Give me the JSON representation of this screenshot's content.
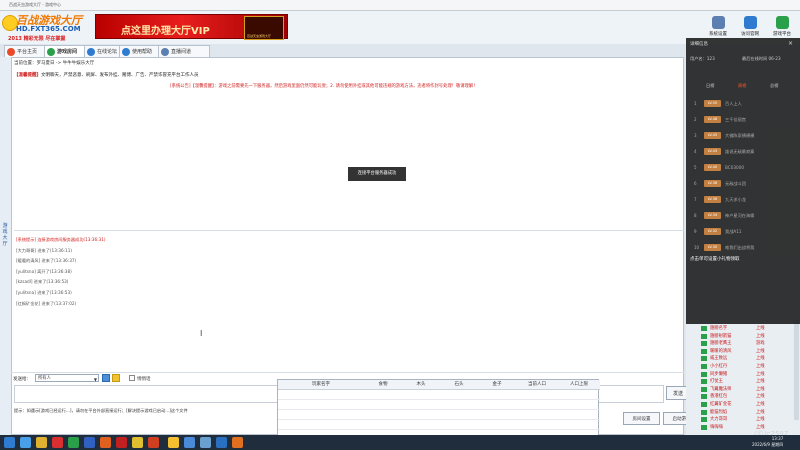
{
  "window": {
    "title": "百战天虫游戏大厅 - 游戏中心"
  },
  "logo": {
    "line1": "百战游戏大厅",
    "line2": "HD.FXT365.COM",
    "line3": "2013 精彩无限 尽在掌握"
  },
  "banner": {
    "text": "点这里办理大厅VIP",
    "emblem": "百战天虫游戏大厅"
  },
  "header_buttons": [
    {
      "label": "系统设置",
      "color": "#5a7fb0"
    },
    {
      "label": "访问官网",
      "color": "#2f7bd0"
    },
    {
      "label": "游戏平台",
      "color": "#2aa04a"
    }
  ],
  "tabs": [
    {
      "label": "平台主页",
      "color": "#e84a2a"
    },
    {
      "label": "游戏房间",
      "color": "#2aa04a"
    },
    {
      "label": "在线论坛",
      "color": "#2f7bd0"
    },
    {
      "label": "使用帮助",
      "color": "#2f7bd0"
    },
    {
      "label": "直播间道",
      "color": "#5a7fb0"
    }
  ],
  "location": "当前位置：罗马夏日 -> 牛牛牛娱乐大厅",
  "warning": {
    "prefix": "【温馨提醒】",
    "text": "文明聊天，严禁恶意、刷屏、发布外挂、赌博、广告、严禁诈冒充平台工作人员"
  },
  "system_message": "[系统公告]【温馨提醒】：游戏之前需要先一下服务器，然后游戏里面仍然可能玩耍；2. 请勿使用外挂或其他可能违规的游戏方法，违者将作封号处理！敬请理解！",
  "toast": "连接平台服务器成功",
  "left_vertical_label": "游戏大厅",
  "log": [
    {
      "text": "[系统提示] 连接游戏房间服务器成功(13:36:31)",
      "style": "red"
    },
    {
      "text": "[大力哥哥] 进来了(13:36:11)",
      "style": "normal"
    },
    {
      "text": "[暖暖的清风] 进来了(13:36:37)",
      "style": "normal"
    },
    {
      "text": "[yulitsna] 离开了(13:36:38)",
      "style": "normal"
    },
    {
      "text": "[kzsadl] 进来了(13:36:53)",
      "style": "normal"
    },
    {
      "text": "[yulitsna] 进来了(13:36:53)",
      "style": "normal"
    },
    {
      "text": "[红枫矿金花] 进来了(13:37:02)",
      "style": "normal"
    }
  ],
  "send": {
    "label": "发送给：",
    "target": "所有人",
    "checkbox_label": "悄悄话",
    "button": "发送"
  },
  "tip": "提示：如遇示[游戏已经运行...]，请勿在平台外部直接运行；[解决提示游戏已启动...]这个文件",
  "buttons": {
    "room_settings": "房间设置",
    "start_game": "启动游戏"
  },
  "stats_table": {
    "headers": [
      "玩家名字",
      "食物",
      "木头",
      "石头",
      "金子",
      "当前人口",
      "人口上限"
    ]
  },
  "overlay": {
    "title": "详细信息",
    "sub_left": "用户名：123",
    "sub_right": "最后在线时间 06-23",
    "tabs": [
      "日榜",
      "周榜",
      "总榜"
    ],
    "active_tab": 1,
    "items": [
      {
        "n": "1",
        "badge": "LV.50",
        "name": "百人上人"
      },
      {
        "n": "2",
        "badge": "LV.48",
        "name": "三千佳丽宫"
      },
      {
        "n": "3",
        "badge": "LV.45",
        "name": "大佛陈家横横横"
      },
      {
        "n": "4",
        "badge": "LV.43",
        "name": "誰说无敌最寂寞"
      },
      {
        "n": "5",
        "badge": "LV.40",
        "name": "BC03000"
      },
      {
        "n": "6",
        "badge": "LV.38",
        "name": "无敌战斗团"
      },
      {
        "n": "7",
        "badge": "LV.36",
        "name": "九天求小龙"
      },
      {
        "n": "8",
        "badge": "LV.34",
        "name": "神户星河在海啸"
      },
      {
        "n": "9",
        "badge": "LV.32",
        "name": "我战A11"
      },
      {
        "n": "10",
        "badge": "LV.30",
        "name": "唯我们出战将我"
      }
    ],
    "message": "点击单可设置小礼物领取"
  },
  "user_list": [
    {
      "name": "翅膀名字",
      "status": "上线"
    },
    {
      "name": "翅膀射箭猫",
      "status": "上线"
    },
    {
      "name": "翅膀老鹰王",
      "status": "游戏"
    },
    {
      "name": "暖暖的清风",
      "status": "上线"
    },
    {
      "name": "威王致远",
      "status": "上线"
    },
    {
      "name": "小小红丹",
      "status": "上线"
    },
    {
      "name": "同步懒猪",
      "status": "上线"
    },
    {
      "name": "打仗王",
      "status": "上线"
    },
    {
      "name": "飞翼魔法师",
      "status": "上线"
    },
    {
      "name": "香港红包",
      "status": "上线"
    },
    {
      "name": "红翼矿金花",
      "status": "上线"
    },
    {
      "name": "能猫烈焰",
      "status": "上线"
    },
    {
      "name": "大力哥哥",
      "status": "上线"
    },
    {
      "name": "嗨嗨嗨",
      "status": "上线"
    }
  ],
  "watermark": "(©)c2597",
  "clock": {
    "time": "13:37",
    "date": "2022/6/9 星期四"
  }
}
